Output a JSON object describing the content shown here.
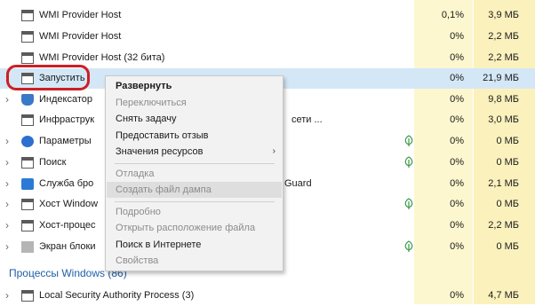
{
  "rows": [
    {
      "name": "WMI Provider Host",
      "cpu": "0,1%",
      "mem": "3,9 МБ",
      "icon": "window-icon"
    },
    {
      "name": "WMI Provider Host",
      "cpu": "0%",
      "mem": "2,2 МБ",
      "icon": "window-icon"
    },
    {
      "name": "WMI Provider Host (32 бита)",
      "cpu": "0%",
      "mem": "2,2 МБ",
      "icon": "window-icon"
    },
    {
      "name": "Запустить",
      "cpu": "0%",
      "mem": "21,9 МБ",
      "icon": "window-icon"
    },
    {
      "name": "Индексатор",
      "cpu": "0%",
      "mem": "9,8 МБ",
      "icon": "search-index-icon"
    },
    {
      "name": "Инфраструк",
      "suffix": "сети ...",
      "cpu": "0%",
      "mem": "3,0 МБ",
      "icon": "network-icon"
    },
    {
      "name": "Параметры",
      "cpu": "0%",
      "mem": "0 МБ",
      "icon": "gear-icon"
    },
    {
      "name": "Поиск",
      "cpu": "0%",
      "mem": "0 МБ",
      "icon": "search-icon"
    },
    {
      "name": "Служба бро",
      "suffix": "Guard",
      "cpu": "0%",
      "mem": "2,1 МБ",
      "icon": "shield-icon"
    },
    {
      "name": "Хост Window",
      "cpu": "0%",
      "mem": "0 МБ",
      "icon": "window-icon"
    },
    {
      "name": "Хост-процес",
      "cpu": "0%",
      "mem": "2,2 МБ",
      "icon": "window-icon"
    },
    {
      "name": "Экран блоки",
      "cpu": "0%",
      "mem": "0 МБ",
      "icon": "lock-screen-icon"
    }
  ],
  "section_title": "Процессы Windows (86)",
  "last_row": {
    "name": "Local Security Authority Process (3)",
    "cpu": "0%",
    "mem": "4,7 МБ"
  },
  "menu": {
    "items": [
      {
        "label": "Развернуть",
        "state": "bold"
      },
      {
        "label": "Переключиться",
        "state": "disabled"
      },
      {
        "label": "Снять задачу",
        "state": "normal"
      },
      {
        "label": "Предоставить отзыв",
        "state": "normal"
      },
      {
        "label": "Значения ресурсов",
        "state": "normal",
        "submenu": true
      },
      {
        "label": "Отладка",
        "state": "disabled"
      },
      {
        "label": "Создать файл дампа",
        "state": "disabled"
      },
      {
        "label": "Подробно",
        "state": "disabled"
      },
      {
        "label": "Открыть расположение файла",
        "state": "disabled"
      },
      {
        "label": "Поиск в Интернете",
        "state": "normal"
      },
      {
        "label": "Свойства",
        "state": "disabled"
      }
    ],
    "submenu_arrow": "›"
  },
  "colors": {
    "accent_ring": "#cc1f25",
    "selected_row": "#d4e7f6",
    "section_title": "#1f5fa6"
  }
}
